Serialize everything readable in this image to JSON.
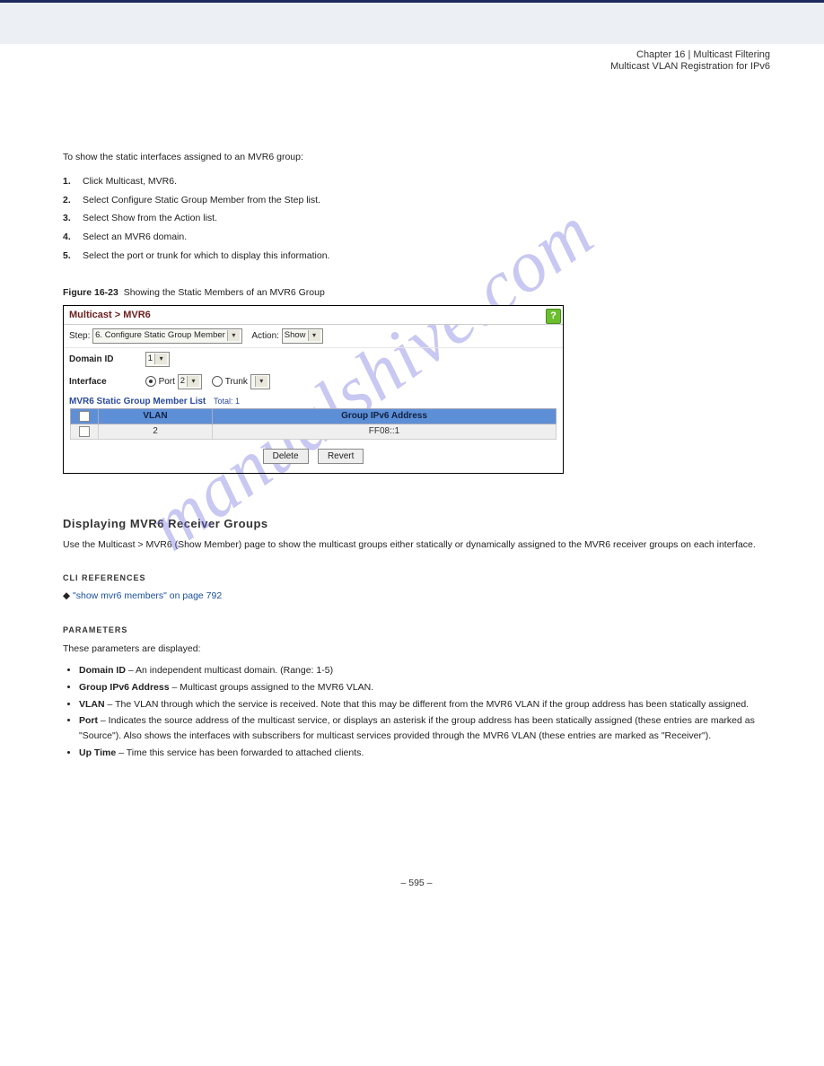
{
  "header": {
    "chapter_line": "Chapter 16",
    "chapter_sep": "| ",
    "chapter_name": "Multicast Filtering",
    "subtitle": "Multicast VLAN Registration for IPv6"
  },
  "intro": "To show the static interfaces assigned to an MVR6 group:",
  "steps": [
    "Click Multicast, MVR6.",
    "Select Configure Static Group Member from the Step list.",
    "Select Show from the Action list.",
    "Select an MVR6 domain.",
    "Select the port or trunk for which to display this information."
  ],
  "figure": {
    "num": "Figure 16-23",
    "title": "Showing the Static Members of an MVR6 Group"
  },
  "panel": {
    "breadcrumb": "Multicast > MVR6",
    "help": "?",
    "step_label": "Step:",
    "step_value": "6. Configure Static Group Member",
    "action_label": "Action:",
    "action_value": "Show",
    "domain_label": "Domain ID",
    "domain_value": "1",
    "interface_label": "Interface",
    "port_label": "Port",
    "port_value": "2",
    "trunk_label": "Trunk",
    "trunk_value": "",
    "list_title": "MVR6 Static Group Member List",
    "list_total": "Total: 1",
    "th_vlan": "VLAN",
    "th_group": "Group IPv6 Address",
    "rows": [
      {
        "vlan": "2",
        "group": "FF08::1"
      }
    ],
    "btn_delete": "Delete",
    "btn_revert": "Revert"
  },
  "section": {
    "head": "Displaying MVR6 Receiver Groups",
    "para": "Use the Multicast > MVR6 (Show Member) page to show the multicast groups either statically or dynamically assigned to the MVR6 receiver groups on each interface.",
    "cli_h": "CLI REFERENCES",
    "cli_ref_prefix": "◆ ",
    "cli_ref_link": "\"show mvr6 members\" on page 792",
    "param_h": "PARAMETERS",
    "param_intro": "These parameters are displayed:",
    "params": [
      {
        "label": "Domain ID",
        "desc": " – An independent multicast domain. (Range: 1-5)"
      },
      {
        "label": "Group IPv6 Address",
        "desc": " – Multicast groups assigned to the MVR6 VLAN."
      },
      {
        "label": "VLAN",
        "desc": " – The VLAN through which the service is received. Note that this may be different from the MVR6 VLAN if the group address has been statically assigned."
      },
      {
        "label": "Port",
        "desc": " – Indicates the source address of the multicast service, or displays an asterisk if the group address has been statically assigned (these entries are marked as \"Source\"). Also shows the interfaces with subscribers for multicast services provided through the MVR6 VLAN (these entries are marked as \"Receiver\")."
      },
      {
        "label": "Up Time",
        "desc": " – Time this service has been forwarded to attached clients."
      }
    ]
  },
  "footer": {
    "page": "– 595 –"
  },
  "watermark": "manualshive.com"
}
